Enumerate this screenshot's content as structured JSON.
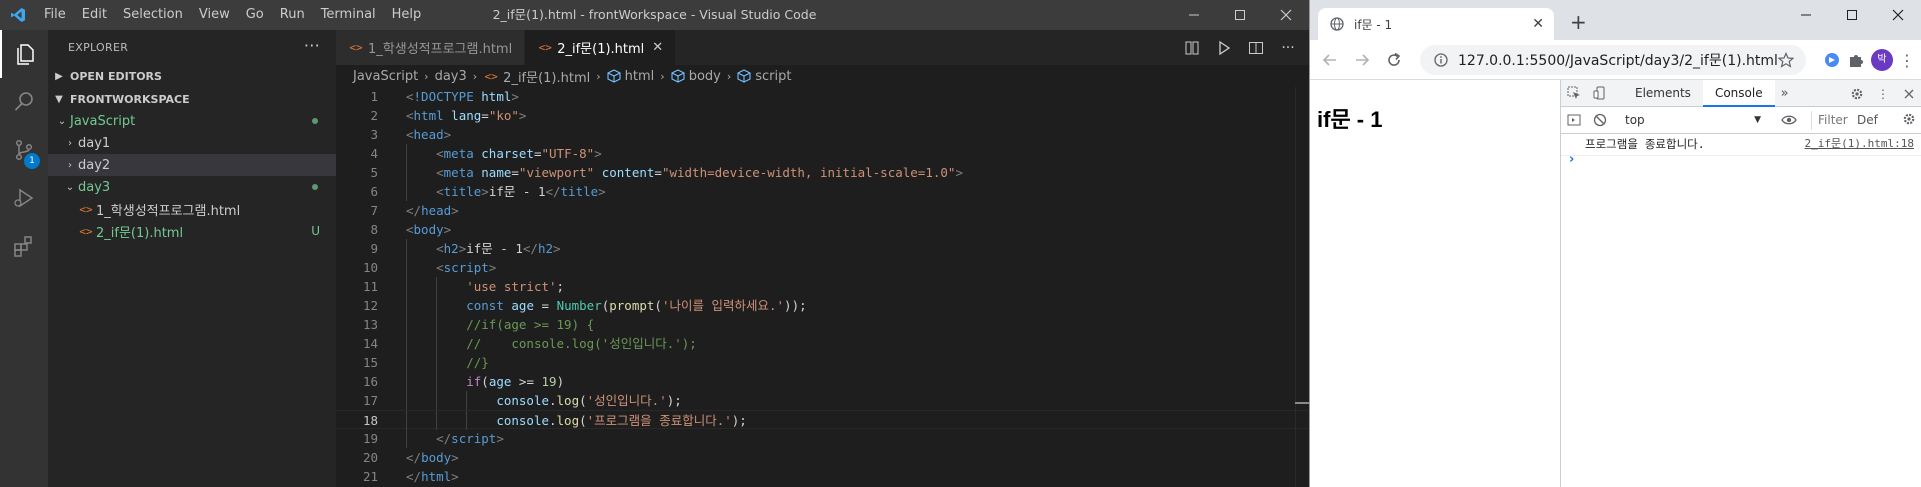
{
  "vscode": {
    "menu": [
      "File",
      "Edit",
      "Selection",
      "View",
      "Go",
      "Run",
      "Terminal",
      "Help"
    ],
    "window_title": "2_if문(1).html - frontWorkspace - Visual Studio Code",
    "scm_badge": "1",
    "explorer_title": "EXPLORER",
    "open_editors": "OPEN EDITORS",
    "workspace": "FRONTWORKSPACE",
    "tree": {
      "javascript": "JavaScript",
      "day1": "day1",
      "day2": "day2",
      "day3": "day3",
      "file1": "1_학생성적프로그램.html",
      "file2": "2_if문(1).html",
      "file2_status": "U"
    },
    "tabs": [
      "1_학생성적프로그램.html",
      "2_if문(1).html"
    ],
    "breadcrumb": [
      "JavaScript",
      "day3",
      "2_if문(1).html",
      "html",
      "body",
      "script"
    ],
    "current_line": 18,
    "colors": {
      "accent": "#007acc",
      "untracked": "#73c991"
    }
  },
  "chrome": {
    "tab_title": "if문 - 1",
    "url": "127.0.0.1:5500/JavaScript/day3/2_if문(1).html",
    "avatar": "박",
    "page_heading": "if문 - 1",
    "devtools": {
      "tabs": [
        "Elements",
        "Console"
      ],
      "active_tab": "Console",
      "context": "top",
      "filter_placeholder": "Filter",
      "levels": "Def",
      "log_message": "프로그램을 종료합니다.",
      "log_source": "2_if문(1).html:18",
      "prompt": "›"
    }
  }
}
